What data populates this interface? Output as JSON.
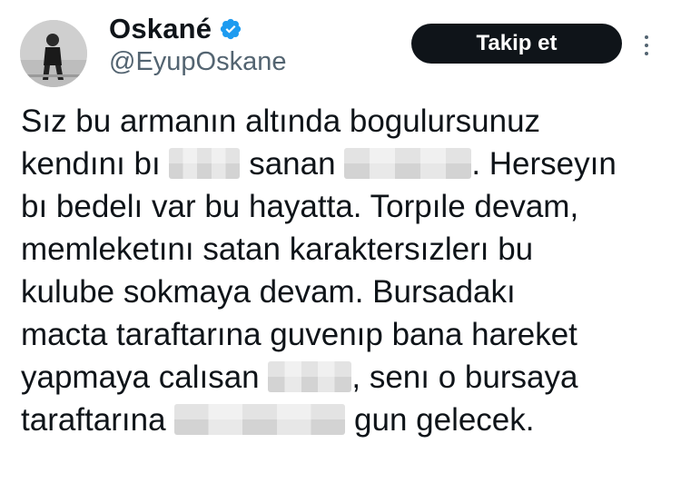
{
  "header": {
    "display_name": "Oskané",
    "handle": "@EyupOskane",
    "follow_label": "Takip et",
    "verified_color": "#1d9bf0"
  },
  "icons": {
    "verified": "verified-badge-icon",
    "more": "more-vertical-icon",
    "avatar": "avatar"
  },
  "tweet": {
    "line1": "Sız bu armanın altında bogulursunuz",
    "line2_a": "kendını bı",
    "line2_b": "sanan",
    "line2_c": ". Herseyın",
    "line3": "bı bedelı var bu hayatta. Torpıle devam,",
    "line4": "memleketını satan karaktersızlerı bu",
    "line5": "kulube sokmaya devam. Bursadakı",
    "line6": "macta taraftarına guvenıp bana hareket",
    "line7_a": "yapmaya calısan",
    "line7_b": ", senı o bursaya",
    "line8_a": "taraftarına",
    "line8_b": "gun gelecek."
  }
}
